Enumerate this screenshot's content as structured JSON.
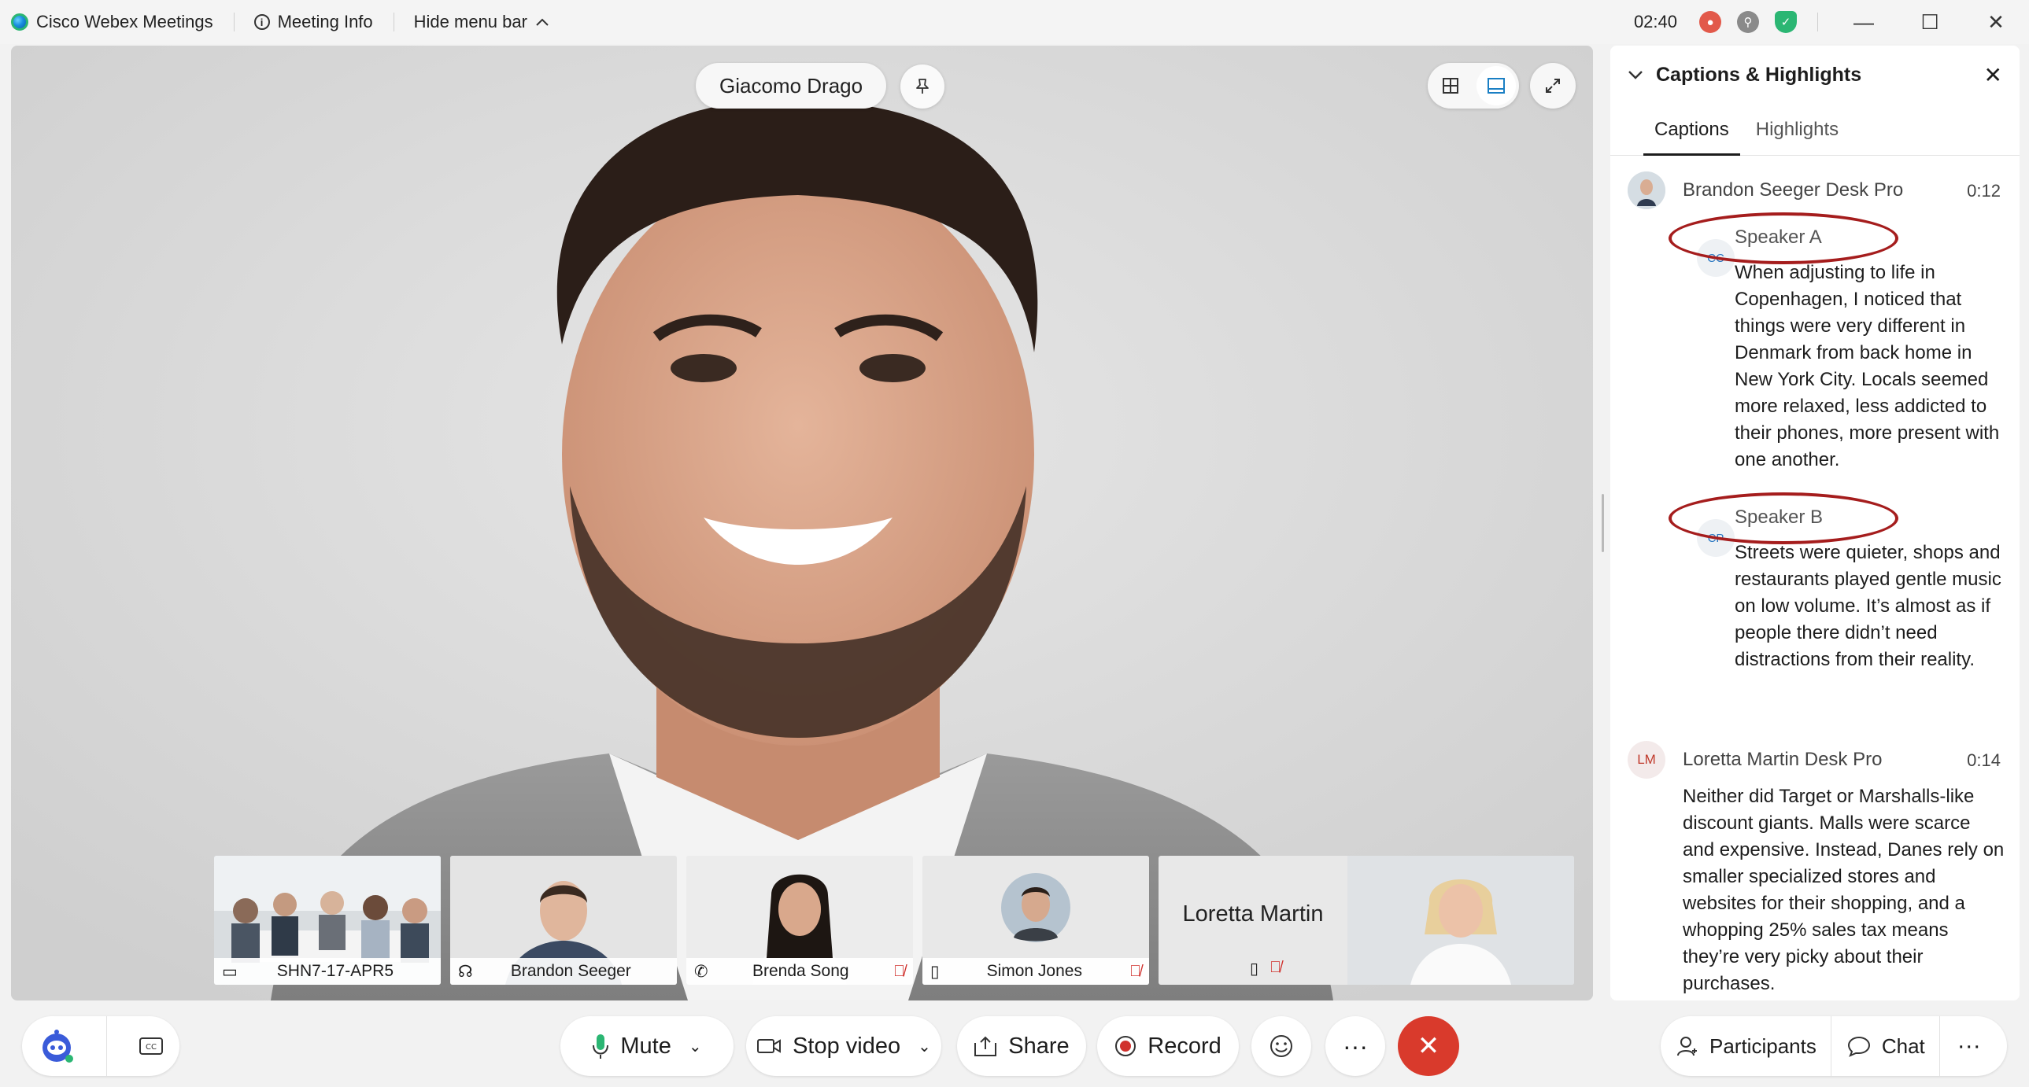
{
  "titlebar": {
    "app_name": "Cisco Webex Meetings",
    "meeting_info": "Meeting Info",
    "hide_menu": "Hide menu bar",
    "timer": "02:40"
  },
  "stage": {
    "active_speaker": "Giacomo Drago"
  },
  "thumbnails": [
    {
      "name": "SHN7-17-APR5",
      "icon": "room-device-icon",
      "muted": false
    },
    {
      "name": "Brandon Seeger",
      "icon": "headset-icon",
      "muted": false
    },
    {
      "name": "Brenda Song",
      "icon": "phone-icon",
      "muted": true
    },
    {
      "name": "Simon Jones",
      "icon": "mobile-icon",
      "muted": true
    }
  ],
  "loretta_tile": {
    "name": "Loretta Martin"
  },
  "panel": {
    "title": "Captions & Highlights",
    "tabs": [
      "Captions",
      "Highlights"
    ],
    "entries": [
      {
        "name": "Brandon Seeger Desk Pro",
        "time": "0:12",
        "speakers": [
          {
            "avatar": "CC",
            "label": "Speaker A",
            "text": "When adjusting to life in Copenhagen, I noticed that things were very different in Denmark from back home in New York City. Locals seemed more relaxed, less addicted to their phones, more present with one another."
          },
          {
            "avatar": "CP",
            "label": "Speaker B",
            "text": "Streets were quieter, shops and restaurants played gentle music on low volume. It’s almost as if people there didn’t need distractions from their reality."
          }
        ]
      },
      {
        "name": "Loretta Martin Desk Pro",
        "avatar": "LM",
        "time": "0:14",
        "text": "Neither did Target or Marshalls-like discount giants. Malls were scarce and expensive. Instead, Danes rely on smaller specialized stores and websites for their shopping, and a whopping 25% sales tax means they’re very picky about their purchases."
      }
    ]
  },
  "controls": {
    "mute": "Mute",
    "stop_video": "Stop video",
    "share": "Share",
    "record": "Record",
    "participants": "Participants",
    "chat": "Chat"
  },
  "colors": {
    "end_call": "#d93a2c",
    "mic_green": "#2bb673",
    "record_red": "#d0312d",
    "highlight_ellipse": "#a51d1d"
  }
}
